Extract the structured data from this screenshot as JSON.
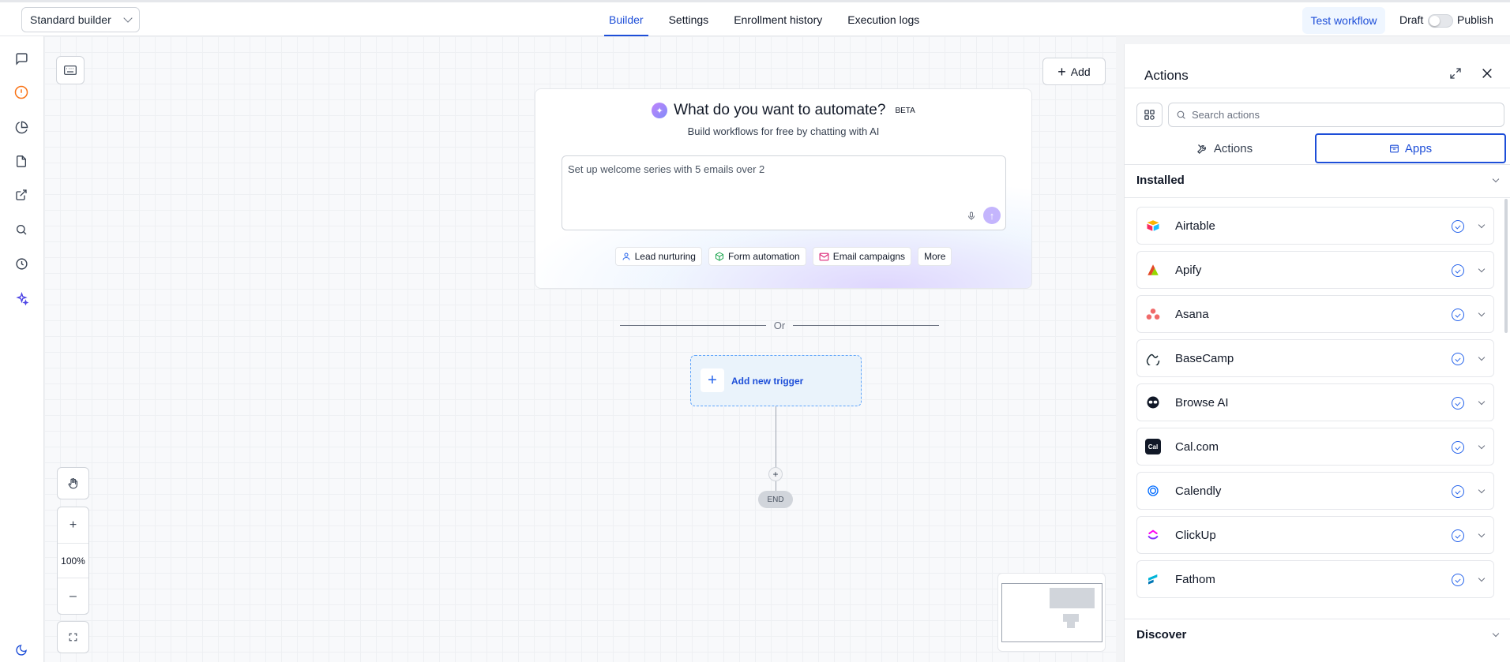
{
  "topbar": {
    "builder_select": "Standard builder",
    "tabs": [
      {
        "label": "Builder",
        "active": true
      },
      {
        "label": "Settings",
        "active": false
      },
      {
        "label": "Enrollment history",
        "active": false
      },
      {
        "label": "Execution logs",
        "active": false
      }
    ],
    "test_workflow": "Test workflow",
    "draft": "Draft",
    "publish": "Publish",
    "publish_enabled": false
  },
  "leftnav": {
    "icons": [
      "chat-icon",
      "alert-circle-icon",
      "pie-chart-icon",
      "document-icon",
      "external-link-icon",
      "search-icon",
      "history-icon",
      "sparkles-icon",
      "moon-icon"
    ],
    "active_color": "#f97316",
    "accent_color": "#4f46e5"
  },
  "canvas": {
    "add_button": "Add",
    "ai": {
      "title": "What do you want to automate?",
      "beta": "BETA",
      "subtitle": "Build workflows for free by chatting with AI",
      "input_value": "Set up welcome series with 5 emails over 2",
      "chips": [
        "Lead nurturing",
        "Form automation",
        "Email campaigns",
        "More"
      ]
    },
    "or": "Or",
    "trigger_label": "Add new trigger",
    "end_label": "END",
    "zoom": "100%"
  },
  "panel": {
    "title": "Actions",
    "search_placeholder": "Search actions",
    "tab_actions": "Actions",
    "tab_apps": "Apps",
    "installed": "Installed",
    "discover": "Discover",
    "apps": [
      {
        "name": "Airtable",
        "logo": "airtable-logo-icon",
        "color": "#fcb400"
      },
      {
        "name": "Apify",
        "logo": "apify-logo-icon",
        "color": "#e34a26"
      },
      {
        "name": "Asana",
        "logo": "asana-logo-icon",
        "color": "#f06a6a"
      },
      {
        "name": "BaseCamp",
        "logo": "basecamp-logo-icon",
        "color": "#1d2d35"
      },
      {
        "name": "Browse AI",
        "logo": "browse-ai-logo-icon",
        "color": "#111827"
      },
      {
        "name": "Cal.com",
        "logo": "calcom-logo-icon",
        "color": "#111827"
      },
      {
        "name": "Calendly",
        "logo": "calendly-logo-icon",
        "color": "#006bff"
      },
      {
        "name": "ClickUp",
        "logo": "clickup-logo-icon",
        "color": "#7b68ee"
      },
      {
        "name": "Fathom",
        "logo": "fathom-logo-icon",
        "color": "#00b4d8"
      }
    ]
  }
}
